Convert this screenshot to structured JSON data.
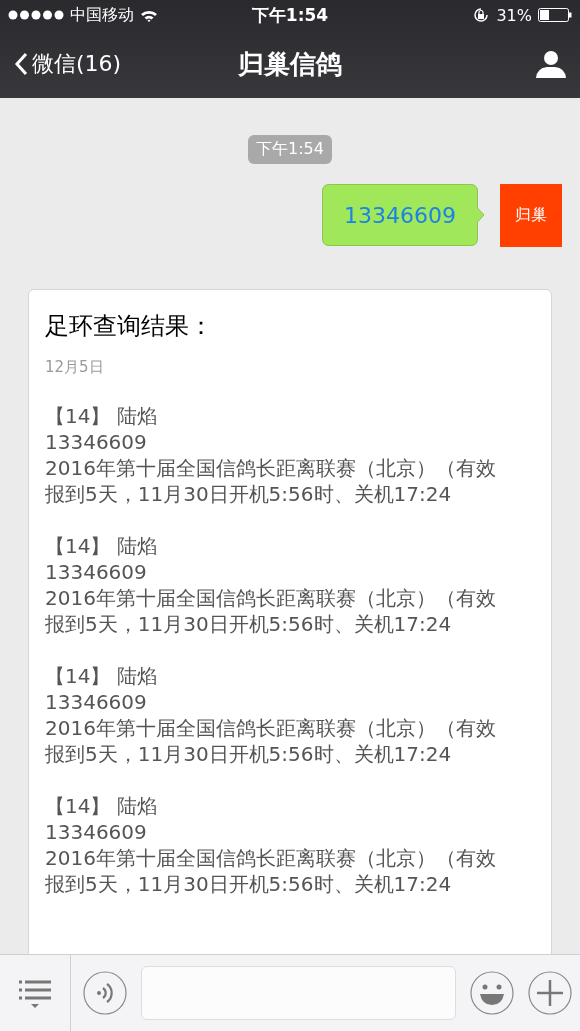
{
  "status_bar": {
    "carrier": "中国移动",
    "time": "下午1:54",
    "battery": "31%"
  },
  "nav": {
    "back_label": "微信(16)",
    "title": "归巢信鸽"
  },
  "timestamp": "下午1:54",
  "sent_message": {
    "text": "13346609",
    "avatar_text": "归巢"
  },
  "result_card": {
    "title": "足环查询结果：",
    "date": "12月5日",
    "entries": [
      {
        "header": "【14】 陆焰",
        "ring": "13346609",
        "race": "2016年第十届全国信鸽长距离联赛（北京）（有效",
        "detail": "报到5天，11月30日开机5:56时、关机17:24"
      },
      {
        "header": "【14】 陆焰",
        "ring": "13346609",
        "race": "2016年第十届全国信鸽长距离联赛（北京）（有效",
        "detail": "报到5天，11月30日开机5:56时、关机17:24"
      },
      {
        "header": "【14】 陆焰",
        "ring": "13346609",
        "race": "2016年第十届全国信鸽长距离联赛（北京）（有效",
        "detail": "报到5天，11月30日开机5:56时、关机17:24"
      },
      {
        "header": "【14】 陆焰",
        "ring": "13346609",
        "race": "2016年第十届全国信鸽长距离联赛（北京）（有效",
        "detail": "报到5天，11月30日开机5:56时、关机17:24"
      }
    ]
  }
}
